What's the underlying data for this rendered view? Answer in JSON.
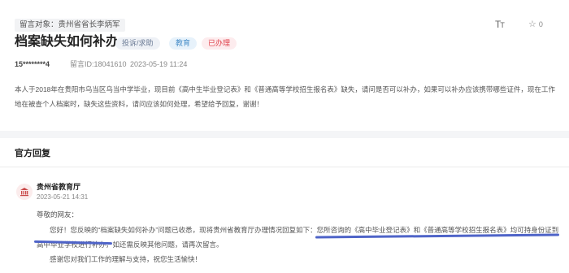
{
  "message": {
    "recipient": "留言对象：贵州省省长李炳军",
    "title": "档案缺失如何补办",
    "tags": {
      "type": "投诉/求助",
      "department": "教育",
      "status": "已办理"
    },
    "user": "15********4",
    "message_id": "留言ID:18041610",
    "date": "2023-05-19 11:24",
    "star_count": "0",
    "body": "本人于2018年在贵阳市乌当区乌当中学毕业，现目前《高中生毕业登记表》和《普通高等学校招生报名表》缺失，请问是否可以补办，如果可以补办应该携带哪些证件，现在工作地在被查个人档案时，缺失这些资料，请问应该如何处理，希望给予回复，谢谢！"
  },
  "reply": {
    "heading": "官方回复",
    "department": "贵州省教育厅",
    "date": "2023-05-21 14:31",
    "greeting": "尊敬的网友：",
    "body_part1": "您好！您反映的“档案缺失如何补办”问题已收悉，现将贵州省教育厅办理情况回复如下：",
    "body_part2": "您所咨询的《高中毕业登记表》和《普通高等学校招生报名表》均可持身份证到高中毕业学校进行补办",
    "body_part3": "，如还需反映其他问题，请再次留言。",
    "closing": "感谢您对我们工作的理解与支持，祝您生活愉快！"
  },
  "colors": {
    "accent_underline": "#4f64c8",
    "status_red": "#e0424c",
    "dept_blue": "#4a8fc9"
  },
  "icons": {
    "font_size": "font-size-icon",
    "star": "star-outline-icon",
    "department": "government-building-icon"
  }
}
